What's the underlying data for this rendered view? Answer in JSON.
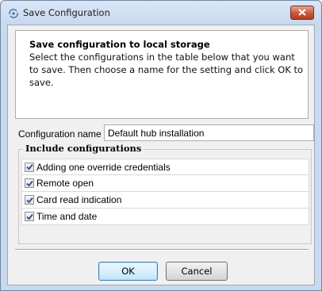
{
  "window": {
    "title": "Save Configuration",
    "icon": "network-sync-icon",
    "close_icon": "close-icon"
  },
  "info": {
    "title": "Save configuration to local storage",
    "description": "Select the configurations in the table below that you want to save. Then choose a name for the setting and click OK to save."
  },
  "config_name": {
    "label": "Configuration name",
    "value": "Default hub installation"
  },
  "include": {
    "legend": "Include configurations",
    "items": [
      {
        "label": "Adding one override credentials",
        "checked": true
      },
      {
        "label": "Remote open",
        "checked": true
      },
      {
        "label": "Card read indication",
        "checked": true
      },
      {
        "label": "Time and date",
        "checked": true
      }
    ]
  },
  "buttons": {
    "ok": "OK",
    "cancel": "Cancel"
  },
  "colors": {
    "frame": "#c9d9ee",
    "close_button": "#c75a3d",
    "checkmark": "#2b4f8f",
    "default_button_border": "#3c7fb1"
  }
}
